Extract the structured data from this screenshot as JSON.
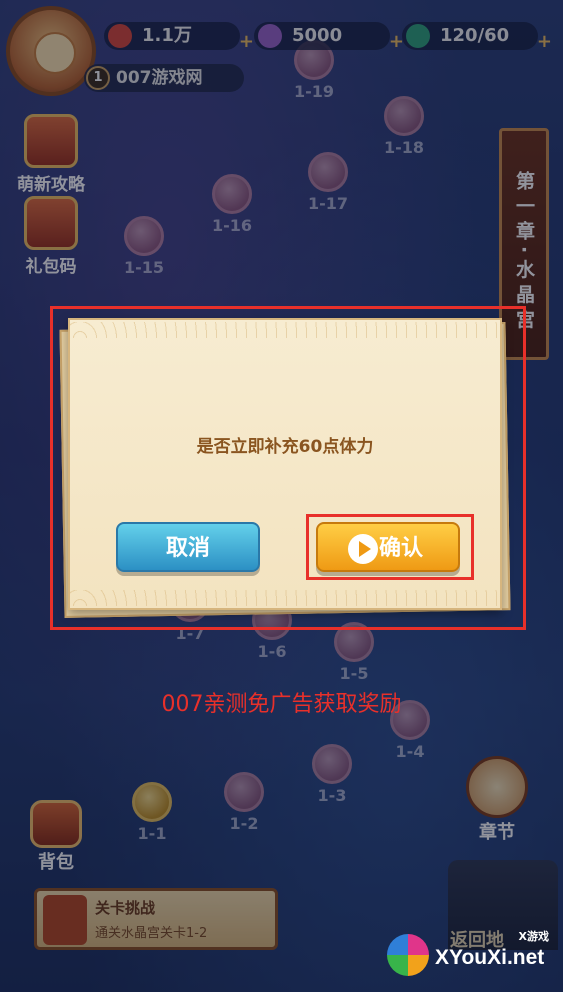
{
  "hud": {
    "coins": "1.1万",
    "gems": "5000",
    "stamina": "120/60",
    "player_level": "1",
    "player_name": "007游戏网",
    "plus": "+"
  },
  "side_menu": {
    "guide_label": "萌新攻略",
    "gift_code_label": "礼包码"
  },
  "chapter_banner": "第一章·水晶宫",
  "levels": [
    "1-19",
    "1-18",
    "1-17",
    "1-16",
    "1-15",
    "1-7",
    "1-6",
    "1-5",
    "1-4",
    "1-3",
    "1-2",
    "1-1"
  ],
  "dialog": {
    "message": "是否立即补充60点体力",
    "cancel_label": "取消",
    "confirm_label": "确认"
  },
  "overlay_text": "007亲测免广告获取奖励",
  "bottom": {
    "bag_label": "背包",
    "chapter_label": "章节",
    "challenge_title": "关卡挑战",
    "challenge_desc": "通关水晶宫关卡1-2",
    "return_label": "返回地"
  },
  "watermark": {
    "small": "X游戏",
    "main": "XYouXi.net"
  },
  "colors": {
    "highlight": "#e8302a",
    "cancel_button": "#2c90c4",
    "confirm_button": "#ef9a14",
    "dialog_text": "#8a5520"
  }
}
